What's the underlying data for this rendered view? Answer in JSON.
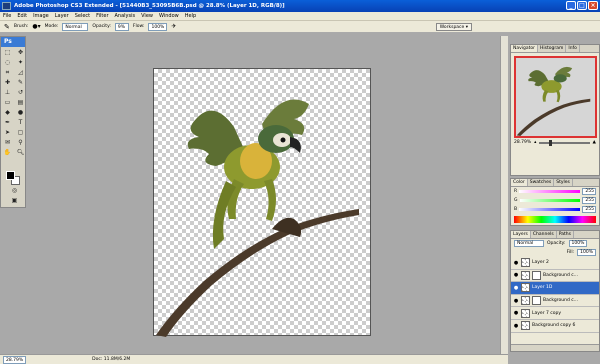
{
  "window": {
    "title": "Adobe Photoshop CS3 Extended - [51440B3_53095B6B.psd @ 28.8% (Layer 1D, RGB/8)]"
  },
  "menu": [
    "File",
    "Edit",
    "Image",
    "Layer",
    "Select",
    "Filter",
    "Analysis",
    "View",
    "Window",
    "Help"
  ],
  "options": {
    "brush_label": "Brush:",
    "mode_label": "Mode:",
    "mode_value": "Normal",
    "opacity_label": "Opacity:",
    "opacity_value": "9%",
    "flow_label": "Flow:",
    "flow_value": "100%",
    "workspace_label": "Workspace ▾"
  },
  "toolbox": {
    "logo": "Ps"
  },
  "status": {
    "zoom": "28.79%",
    "doc": "Doc: 11.8M/6.2M"
  },
  "navigator": {
    "tabs": [
      "Navigator",
      "Histogram",
      "Info"
    ],
    "zoom": "28.79%"
  },
  "color": {
    "tabs": [
      "Color",
      "Swatches",
      "Styles"
    ],
    "rows": [
      {
        "label": "R",
        "value": "255",
        "color": "#ff00ff"
      },
      {
        "label": "G",
        "value": "255",
        "color": "#00ff00"
      },
      {
        "label": "B",
        "value": "255",
        "color": "#0000ff"
      }
    ]
  },
  "layers": {
    "tabs": [
      "Layers",
      "Channels",
      "Paths"
    ],
    "blend_mode": "Normal",
    "opacity_label": "Opacity:",
    "opacity_value": "100%",
    "fill_label": "Fill:",
    "fill_value": "100%",
    "items": [
      {
        "name": "Layer 2",
        "selected": false
      },
      {
        "name": "Background c...",
        "selected": false
      },
      {
        "name": "Layer 1D",
        "selected": true
      },
      {
        "name": "Background c...",
        "selected": false
      },
      {
        "name": "Layer 7 copy",
        "selected": false
      },
      {
        "name": "Background copy 6",
        "selected": false
      }
    ]
  },
  "colors": {
    "accent": "#0a5fd8",
    "selected_layer": "#3169c6"
  }
}
